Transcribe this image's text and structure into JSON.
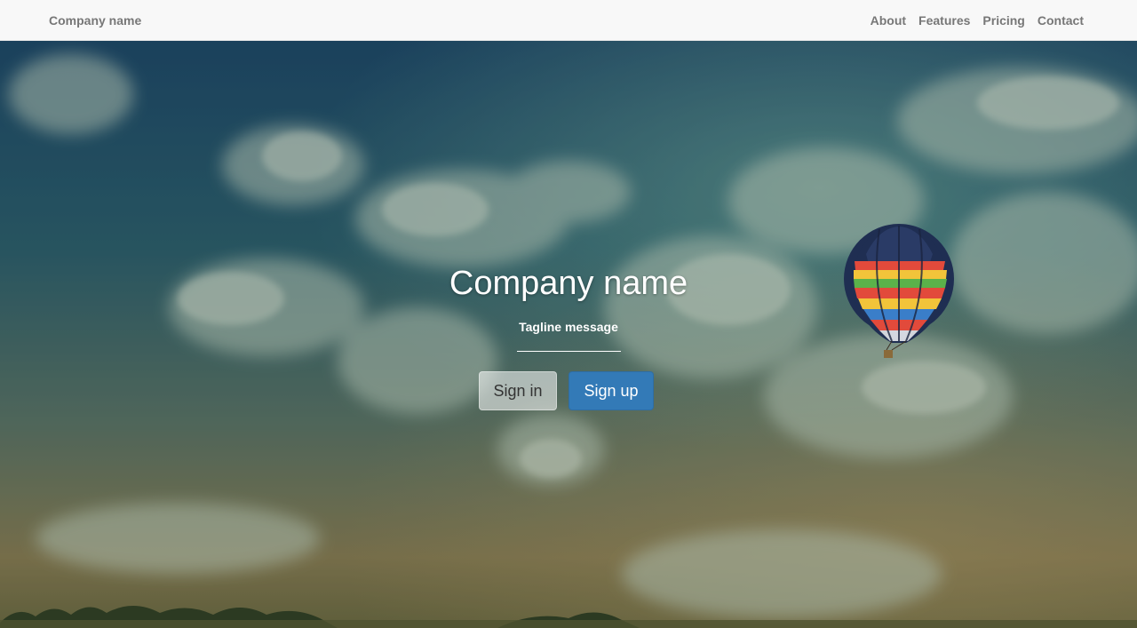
{
  "navbar": {
    "brand": "Company name",
    "links": [
      {
        "label": "About"
      },
      {
        "label": "Features"
      },
      {
        "label": "Pricing"
      },
      {
        "label": "Contact"
      }
    ]
  },
  "hero": {
    "title": "Company name",
    "tagline": "Tagline message",
    "buttons": {
      "signin_label": "Sign in",
      "signup_label": "Sign up"
    }
  },
  "colors": {
    "navbar_bg": "#f8f8f8",
    "nav_text": "#777777",
    "primary": "#337ab7",
    "sky_top": "#1d4766",
    "sky_bottom": "#8c7d4f"
  }
}
